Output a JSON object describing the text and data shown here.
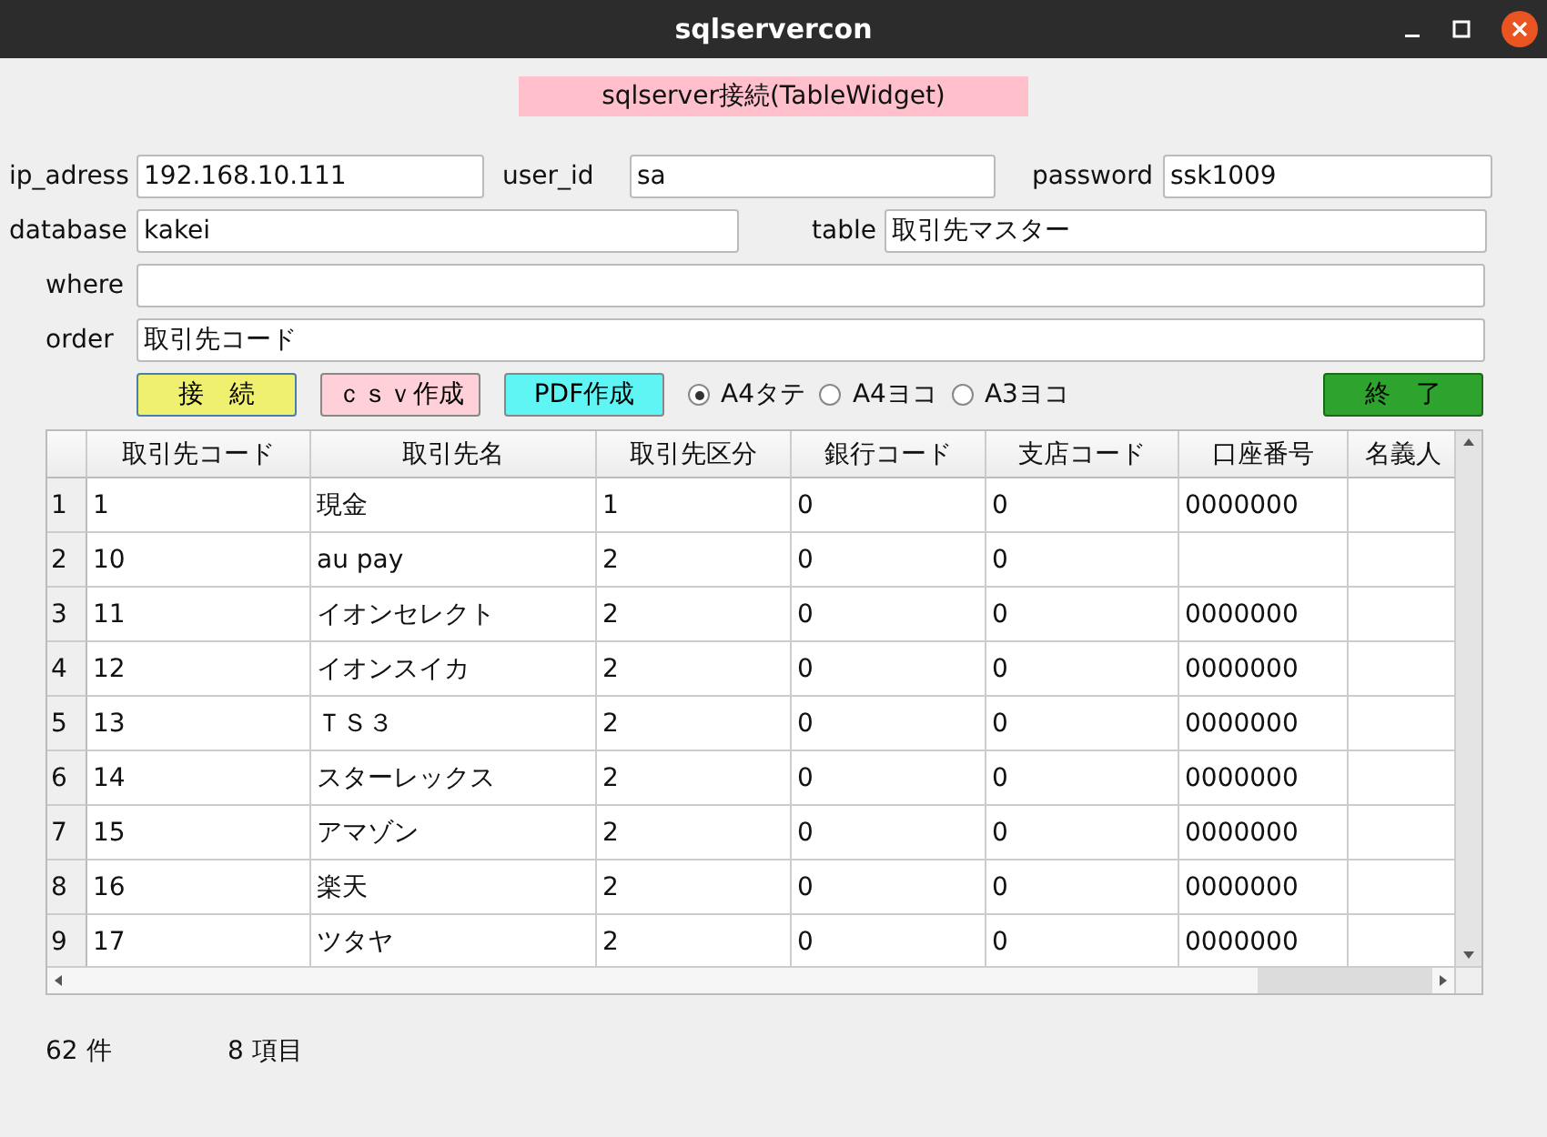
{
  "window": {
    "title": "sqlservercon"
  },
  "heading": "sqlserver接続(TableWidget)",
  "form": [
    [
      {
        "label": "ip_adress",
        "value": "192.168.10.111"
      },
      {
        "label": "user_id",
        "value": "sa"
      },
      {
        "label": "password",
        "value": "ssk1009"
      }
    ],
    [
      {
        "label": "database",
        "value": "kakei"
      },
      {
        "label": "table",
        "value": "取引先マスター"
      }
    ],
    [
      {
        "label": "where"
      }
    ],
    [
      {
        "label": "order",
        "value": "取引先コード"
      }
    ]
  ],
  "buttons": [
    {
      "label": "接　続",
      "kind": "connect"
    },
    {
      "label": "ｃｓｖ作成",
      "kind": "csv"
    },
    {
      "label": "PDF作成",
      "kind": "pdf"
    }
  ],
  "paper": [
    {
      "label": "A4タテ",
      "selected": true
    },
    {
      "label": "A4ヨコ",
      "selected": false
    },
    {
      "label": "A3ヨコ",
      "selected": false
    }
  ],
  "close_button": "終　了",
  "table": {
    "columns": [
      "取引先コード",
      "取引先名",
      "取引先区分",
      "銀行コード",
      "支店コード",
      "口座番号",
      "名義人"
    ],
    "rows": [
      {
        "number": "1",
        "cells": [
          "1",
          "現金",
          "1",
          "0",
          "0",
          "0000000"
        ]
      },
      {
        "number": "2",
        "cells": [
          "10",
          "au pay",
          "2",
          "0",
          "0",
          null
        ]
      },
      {
        "number": "3",
        "cells": [
          "11",
          "イオンセレクト",
          "2",
          "0",
          "0",
          "0000000"
        ]
      },
      {
        "number": "4",
        "cells": [
          "12",
          "イオンスイカ",
          "2",
          "0",
          "0",
          "0000000"
        ]
      },
      {
        "number": "5",
        "cells": [
          "13",
          "ＴＳ３",
          "2",
          "0",
          "0",
          "0000000"
        ]
      },
      {
        "number": "6",
        "cells": [
          "14",
          "スターレックス",
          "2",
          "0",
          "0",
          "0000000"
        ]
      },
      {
        "number": "7",
        "cells": [
          "15",
          "アマゾン",
          "2",
          "0",
          "0",
          "0000000"
        ]
      },
      {
        "number": "8",
        "cells": [
          "16",
          "楽天",
          "2",
          "0",
          "0",
          "0000000"
        ]
      },
      {
        "number": "9",
        "cells": [
          "17",
          "ツタヤ",
          "2",
          "0",
          "0",
          "0000000"
        ]
      }
    ]
  },
  "status": {
    "count": "62 件",
    "items": "8 項目"
  }
}
